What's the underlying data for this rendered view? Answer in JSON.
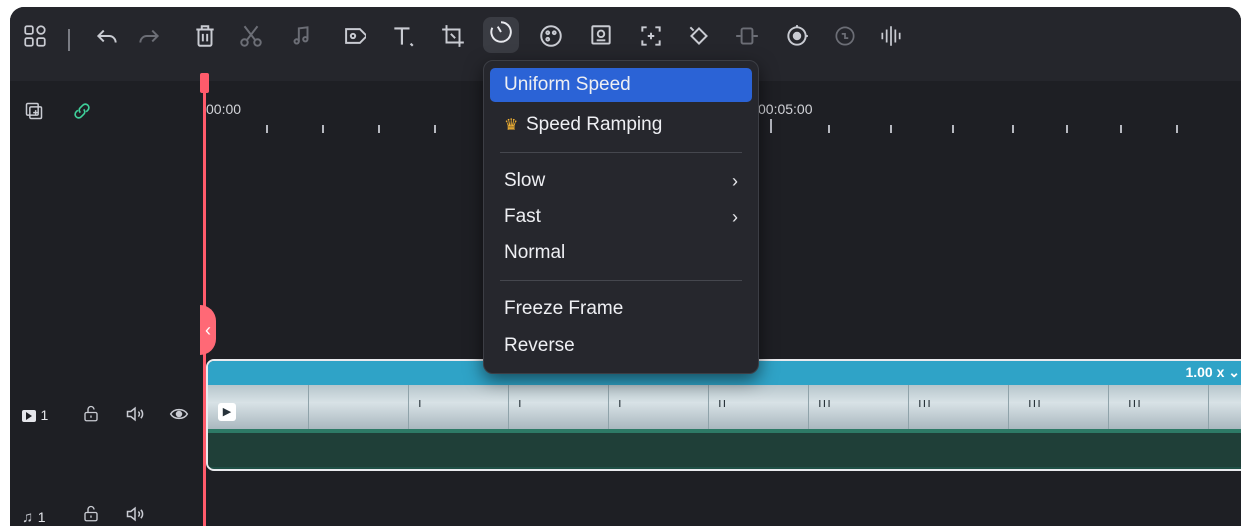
{
  "toolbar": {
    "icons": [
      "layout-icon",
      "undo-icon",
      "redo-icon",
      "delete-icon",
      "cut-icon",
      "audio-icon",
      "tag-icon",
      "text-icon",
      "crop-icon",
      "speed-icon",
      "color-icon",
      "mask-icon",
      "stabilize-icon",
      "keyframe-icon",
      "green-screen-icon",
      "ai-icon",
      "auto-reframe-icon",
      "audio-wave-icon"
    ]
  },
  "ruler": {
    "start_time": "00:00",
    "mid_time": "00:05:00"
  },
  "speed_menu": {
    "items": [
      {
        "label": "Uniform Speed",
        "selected": true
      },
      {
        "label": "Speed Ramping",
        "premium": true
      },
      {
        "label": "Slow",
        "submenu": true
      },
      {
        "label": "Fast",
        "submenu": true
      },
      {
        "label": "Normal"
      },
      {
        "label": "Freeze Frame"
      },
      {
        "label": "Reverse"
      }
    ],
    "submenu_arrow": "›"
  },
  "video_track": {
    "label": "1",
    "clip_speed": "1.00 x"
  },
  "audio_track": {
    "label": "1"
  },
  "colors": {
    "accent_selection": "#2b63d6",
    "playhead": "#ff5b6b",
    "clip_bar": "#2fa3c7",
    "link_icon": "#3fcf9a"
  }
}
